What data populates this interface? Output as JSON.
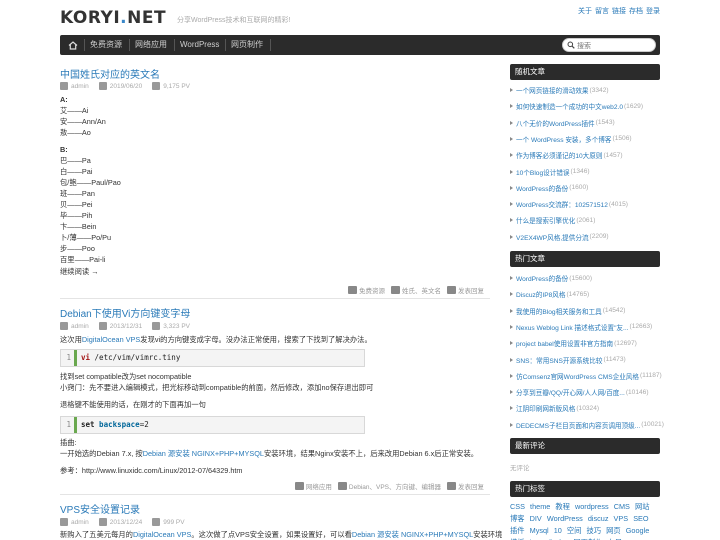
{
  "header": {
    "logo": "KORYI",
    "logo_dot": ".",
    "logo_tail": "NET",
    "tagline": "分享WordPress技术和互联网的精彩!",
    "links": [
      "关于",
      "留言",
      "链接",
      "存档",
      "登录"
    ]
  },
  "nav": {
    "home_icon": "home-icon",
    "items": [
      "免费资源",
      "网络应用",
      "WordPress",
      "网页制作"
    ],
    "search_placeholder": "搜索"
  },
  "posts": [
    {
      "title": "中国姓氏对应的英文名",
      "author": "admin",
      "date": "2019/06/20",
      "views": "9,175 PV",
      "lines": [
        "A:",
        "艾——Ai",
        "安——Ann/An",
        "敖——Ao",
        "B:",
        "巴——Pa",
        "白——Pai",
        "包/鲍——Paul/Pao",
        "班——Pan",
        "贝——Pei",
        "毕——Pih",
        "卞——Bein",
        "卜/薄——Po/Pu",
        "步——Poo",
        "百里——Pai-li"
      ],
      "read_more": "继续阅读 →",
      "category": "免费资源",
      "tags": "姓氏、英文名",
      "comment": "发表回复"
    },
    {
      "title": "Debian下使用Vi方向键变字母",
      "author": "admin",
      "date": "2013/12/31",
      "views": "3,323 PV",
      "intro_before": "这次用",
      "intro_link": "DigitalOcean VPS",
      "intro_after": "发现vi的方向键变成字母。没办法正常使用，搜索了下找到了解决办法。",
      "code1_ln": "1",
      "code1_kw": "vi",
      "code1_rest": " /etc/vim/vimrc.tiny",
      "p1": "找到set compatible改为set nocompatible",
      "p2": "小窍门：先不要进入编辑模式，把光标移动到compatible的前面，然后修改，添加no保存退出即可",
      "p3": "退格键不能使用的话，在刚才的下面再加一句",
      "code2_ln": "1",
      "code2_kw": "set",
      "code2_mid": " backspace",
      "code2_rest": "=2",
      "p4": "插曲:",
      "p5_before": "一开始选的Debian 7.x, 按",
      "p5_link": "Debian 源安装 NGINX+PHP+MYSQL",
      "p5_after": "安装环境，结果Nginx安装不上，后来改用Debian 6.x后正常安装。",
      "ref": "参考：http://www.linuxidc.com/Linux/2012-07/64329.htm",
      "category": "网络应用",
      "tags": "Debian、VPS、方向键、编辑器",
      "comment": "发表回复"
    },
    {
      "title": "VPS安全设置记录",
      "author": "admin",
      "date": "2013/12/24",
      "views": "999 PV",
      "intro_before": "新购入了五美元每月的",
      "intro_link": "DigitalOcean VPS",
      "intro_mid": "。这次做了点VPS安全设置，如果设置好，可以看",
      "intro_link2": "Debian 源安装 NGINX+PHP+MYSQL",
      "intro_after": "安装环境"
    }
  ],
  "sidebar": {
    "random_title": "随机文章",
    "random": [
      {
        "t": "一个网页链接的滑动效果",
        "c": "(3342)"
      },
      {
        "t": "如何快速制造一个成功的中文web2.0",
        "c": "(1629)"
      },
      {
        "t": "八个无价的WordPress插件",
        "c": "(1543)"
      },
      {
        "t": "一个 WordPress 安装，多个博客",
        "c": "(1506)"
      },
      {
        "t": "作为博客必须谨记的10大原则",
        "c": "(1457)"
      },
      {
        "t": "10个Blog设计错误",
        "c": "(1346)"
      },
      {
        "t": "WordPress的备份",
        "c": "(1600)"
      },
      {
        "t": "WordPress交流群：102571512",
        "c": "(4015)"
      },
      {
        "t": "什么是搜索引擎优化",
        "c": "(2061)"
      },
      {
        "t": "V2EX4WP风格,提供分流",
        "c": "(2209)"
      }
    ],
    "hot_title": "热门文章",
    "hot": [
      {
        "t": "WordPress的备份",
        "c": "(15600)"
      },
      {
        "t": "Discuz的IP8风格",
        "c": "(14765)"
      },
      {
        "t": "我使用的Blog相关服务和工具",
        "c": "(14542)"
      },
      {
        "t": "Nexus Weblog Link 描述格式设置\"友...",
        "c": "(12663)"
      },
      {
        "t": "project babel使用设置非官方指南",
        "c": "(12697)"
      },
      {
        "t": "SNS：常用SNS开源系统比较",
        "c": "(11473)"
      },
      {
        "t": "仿Comsenz官网WordPress CMS企业风格",
        "c": "(11187)"
      },
      {
        "t": "分享到豆瓣/QQ/开心网/人人网/百度...",
        "c": "(10146)"
      },
      {
        "t": "江阴印刷网新版风格",
        "c": "(10324)"
      },
      {
        "t": "DEDECMS子栏目页面和内容页调用顶级...",
        "c": "(10021)"
      }
    ],
    "recent_comments_title": "最新评论",
    "recent_comments_text": "无评论",
    "tags_title": "热门标签",
    "tags": [
      "CSS",
      "theme",
      "教程",
      "wordpress",
      "CMS",
      "网站",
      "博客",
      "DIV",
      "WordPress",
      "discuz",
      "VPS",
      "SEO",
      "插件",
      "Mysql",
      "10",
      "空间",
      "技巧",
      "网页",
      "Google",
      "模板",
      "logo",
      "firefox",
      "网页制作",
      "布局"
    ]
  }
}
